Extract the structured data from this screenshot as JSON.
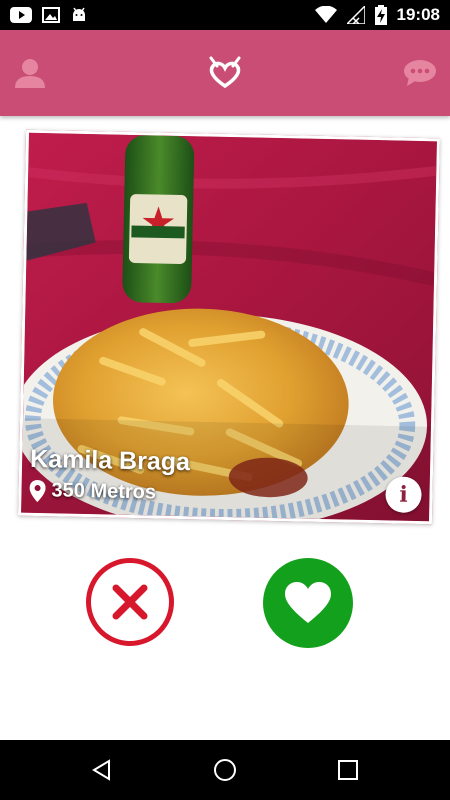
{
  "status_bar": {
    "time": "19:08",
    "icons": [
      "youtube-icon",
      "gallery-icon",
      "android-icon",
      "wifi-icon",
      "signal-icon",
      "battery-charging-icon"
    ]
  },
  "app_bar": {
    "left_icon": "profile-icon",
    "center_icon": "app-logo-icon",
    "right_icon": "chat-icon",
    "color": "#c94d74"
  },
  "card": {
    "name": "Kamila Braga",
    "distance": "350 Metros",
    "info_label": "i",
    "photo_description_icon": "food-photo"
  },
  "actions": {
    "reject_icon": "close-icon",
    "reject_color": "#d7172b",
    "like_icon": "heart-icon",
    "like_color": "#13a01c"
  },
  "nav_bar": {
    "icons": [
      "back-icon",
      "home-icon",
      "recents-icon"
    ]
  }
}
